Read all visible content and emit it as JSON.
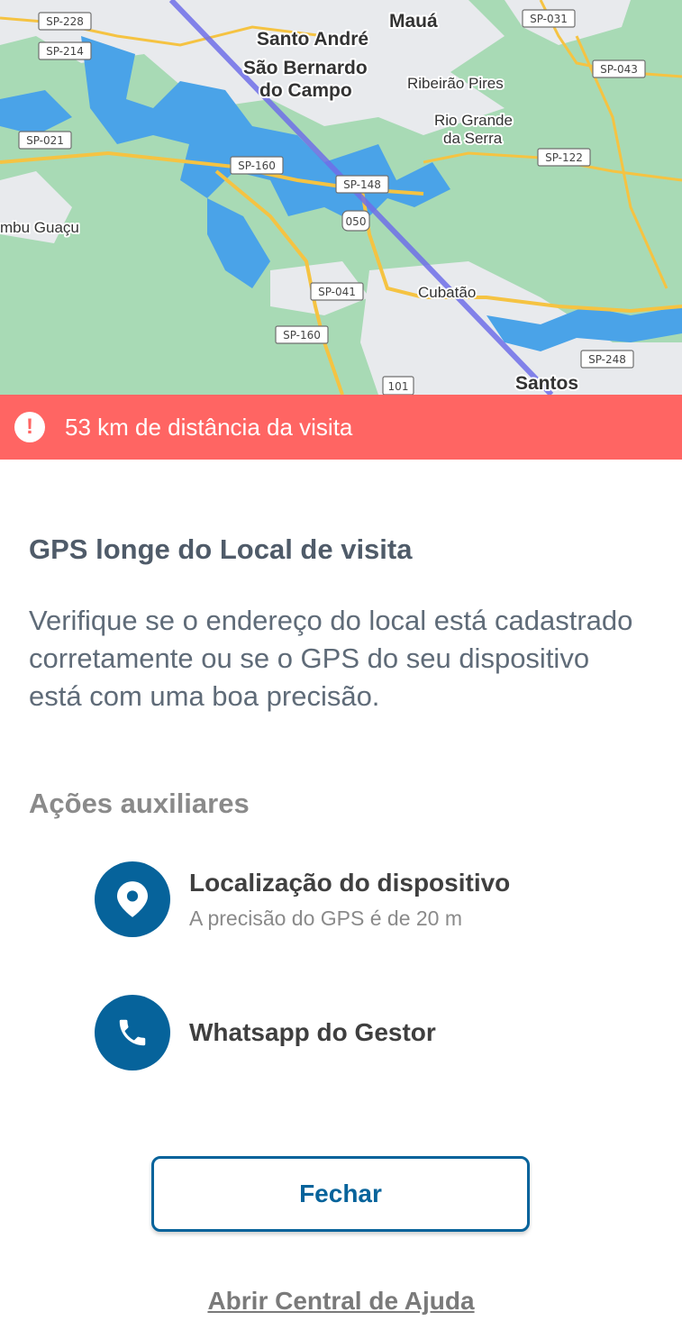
{
  "map": {
    "places": [
      "Santo André",
      "Mauá",
      "São Bernardo",
      "do Campo",
      "Ribeirão Pires",
      "Rio Grande",
      "da Serra",
      "mbu Guaçu",
      "Cubatão",
      "Santos"
    ],
    "road_shields": [
      "SP-228",
      "SP-214",
      "SP-021",
      "SP-031",
      "SP-043",
      "SP-122",
      "SP-160",
      "SP-148",
      "050",
      "SP-041",
      "SP-160",
      "101",
      "SP-248"
    ],
    "colors": {
      "water": "#4aa3e8",
      "land": "#a8dab5",
      "urban": "#e8eaed",
      "road": "#f5c342",
      "route": "#6e6ee8"
    }
  },
  "alert": {
    "text": "53 km de distância da visita",
    "icon": "exclamation-circle-icon",
    "color": "#ff6563"
  },
  "content": {
    "title": "GPS longe do Local de visita",
    "description": "Verifique se o endereço do local está cadastrado corretamente ou se o GPS do seu dispositivo está com uma boa precisão.",
    "section_title": "Ações auxiliares",
    "actions": [
      {
        "icon": "location-pin-icon",
        "title": "Localização do dispositivo",
        "subtitle": "A precisão do GPS é de 20 m"
      },
      {
        "icon": "phone-icon",
        "title": "Whatsapp do Gestor"
      }
    ],
    "close_label": "Fechar",
    "help_link": "Abrir Central de Ajuda",
    "accent_color": "#06639b"
  }
}
